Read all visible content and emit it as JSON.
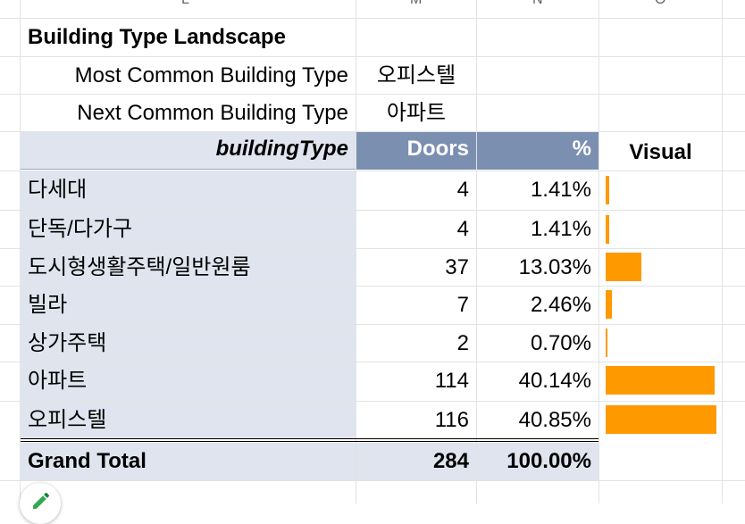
{
  "column_headers": [
    "L",
    "M",
    "N",
    "O"
  ],
  "section_title": "Building Type Landscape",
  "summary": [
    {
      "label": "Most Common Building Type",
      "value": "오피스텔"
    },
    {
      "label": "Next Common Building Type",
      "value": "아파트"
    }
  ],
  "table": {
    "headers": {
      "type": "buildingType",
      "doors": "Doors",
      "pct": "%",
      "visual": "Visual"
    },
    "rows": [
      {
        "type": "다세대",
        "doors": "4",
        "pct": "1.41%",
        "share": 1.41
      },
      {
        "type": "단독/다가구",
        "doors": "4",
        "pct": "1.41%",
        "share": 1.41
      },
      {
        "type": "도시형생활주택/일반원룸",
        "doors": "37",
        "pct": "13.03%",
        "share": 13.03
      },
      {
        "type": "빌라",
        "doors": "7",
        "pct": "2.46%",
        "share": 2.46
      },
      {
        "type": "상가주택",
        "doors": "2",
        "pct": "0.70%",
        "share": 0.7
      },
      {
        "type": "아파트",
        "doors": "114",
        "pct": "40.14%",
        "share": 40.14
      },
      {
        "type": "오피스텔",
        "doors": "116",
        "pct": "40.85%",
        "share": 40.85
      }
    ],
    "total": {
      "label": "Grand Total",
      "doors": "284",
      "pct": "100.00%"
    }
  },
  "colors": {
    "header": "#7b8fb1",
    "shade": "#dfe4ee",
    "bar": "#ff9900",
    "grid": "#e2e3e3"
  }
}
